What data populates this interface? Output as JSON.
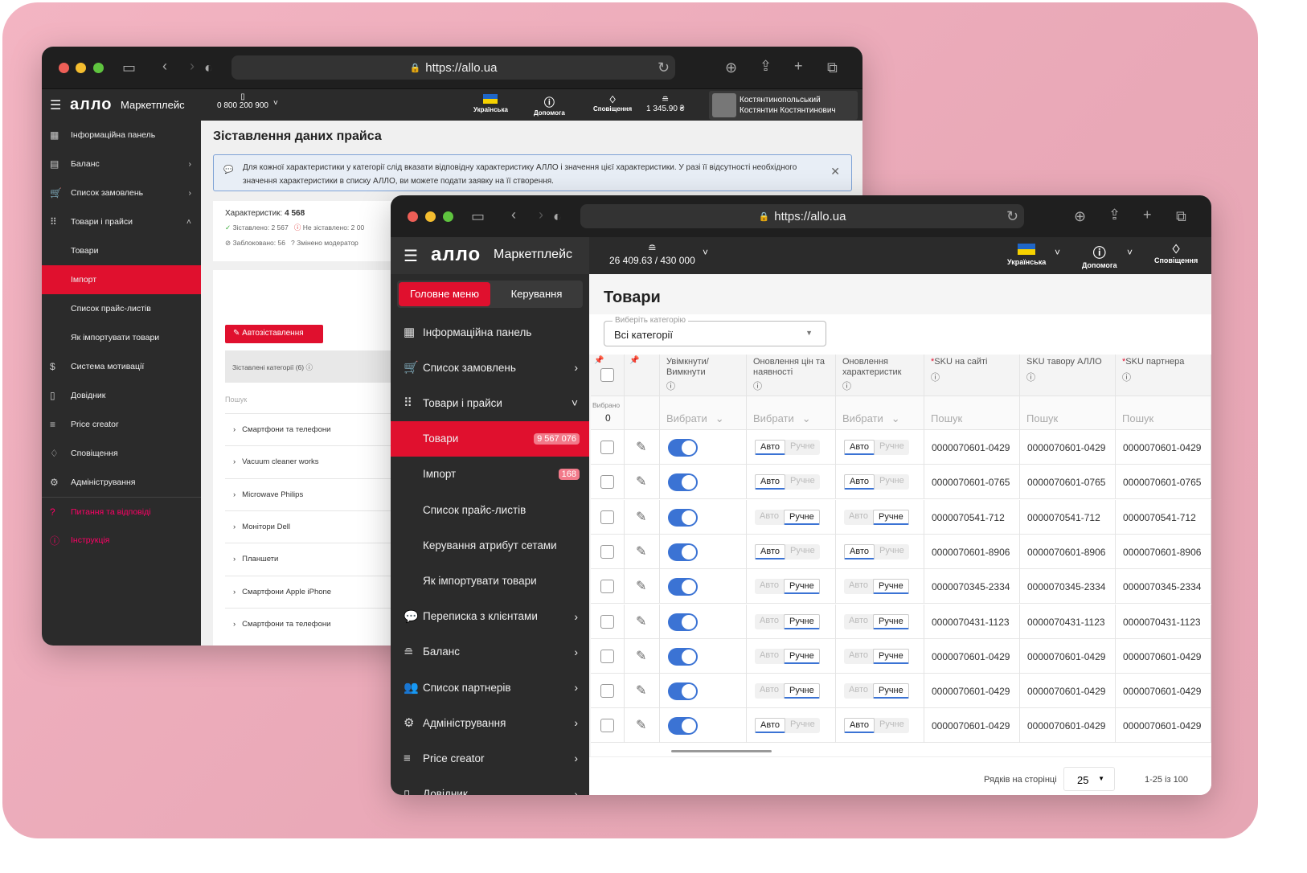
{
  "back": {
    "url": "https://allo.ua",
    "brand": "алло",
    "brand_sub": "Маркетплейс",
    "phone": "0 800 200 900",
    "language": "Українська",
    "help": "Допомога",
    "notifications": "Сповіщення",
    "balance": "1 345.90 ₴",
    "user_line1": "Костянтинопольський",
    "user_line2": "Костянтин Костянтинович",
    "sidebar": [
      {
        "label": "Інформаційна панель",
        "icon": "dashboard-icon",
        "chev": ""
      },
      {
        "label": "Баланс",
        "icon": "wallet-icon",
        "chev": "›"
      },
      {
        "label": "Список замовлень",
        "icon": "cart-icon",
        "chev": "›"
      },
      {
        "label": "Товари і прайси",
        "icon": "grid-icon",
        "chev": "˄"
      },
      {
        "label": "Товари",
        "sub": true
      },
      {
        "label": "Імпорт",
        "sub": true,
        "active": true
      },
      {
        "label": "Список прайс-листів",
        "sub": true
      },
      {
        "label": "Як імпортувати товари",
        "sub": true
      },
      {
        "label": "Система мотивації",
        "icon": "dollar-icon"
      },
      {
        "label": "Довідник",
        "icon": "book-icon"
      },
      {
        "label": "Price creator",
        "icon": "list-check-icon"
      },
      {
        "label": "Сповіщення",
        "icon": "bell-icon"
      },
      {
        "label": "Адміністрування",
        "icon": "gear-icon"
      },
      {
        "label": "Питання та відповіді",
        "icon": "question-icon",
        "red": true
      },
      {
        "label": "Інструкція",
        "icon": "info-icon",
        "red": true
      }
    ],
    "page_title": "Зіставлення даних прайса",
    "alert": "Для кожної характеристики у категорії слід вказати відповідну характеристику АЛЛО і значення цієї характеристики. У разі її відсутності необхідного значення характеристики в списку АЛЛО, ви можете подати заявку на її створення.",
    "stats": {
      "label": "Характеристик:",
      "total": "4 568",
      "matched": "Зіставлено: 2 567",
      "unmatched": "Не зіставлено: 2 00",
      "blocked": "Заблоковано: 56",
      "moderated": "Змінено модератор"
    },
    "auto_button": "Автозіставлення",
    "matched_categories": "Зіставлені категорії (6)",
    "search_placeholder": "Пошук",
    "categories": [
      "Смартфони та телефони",
      "Vacuum cleaner works",
      "Microwave Philips",
      "Монітори Dell",
      "Планшети",
      "Смартфони Apple iPhone",
      "Смартфони та телефони"
    ]
  },
  "front": {
    "url": "https://allo.ua",
    "brand": "алло",
    "brand_sub": "Маркетплейс",
    "balance": "26 409.63 / 430 000",
    "language": "Українська",
    "help": "Допомога",
    "notifications": "Сповіщення",
    "tabs": {
      "main": "Головне меню",
      "manage": "Керування"
    },
    "sidebar": [
      {
        "label": "Інформаційна панель",
        "icon": "dashboard-icon",
        "chev": ""
      },
      {
        "label": "Список замовлень",
        "icon": "cart-icon",
        "chev": "›"
      },
      {
        "label": "Товари і прайси",
        "icon": "grid-icon",
        "chev": "˅"
      },
      {
        "label": "Товари",
        "sub": true,
        "active": true,
        "badge": "9 567 076"
      },
      {
        "label": "Імпорт",
        "sub": true,
        "badge": "168"
      },
      {
        "label": "Список прайс-листів",
        "sub": true
      },
      {
        "label": "Керування атрибут сетами",
        "sub": true
      },
      {
        "label": "Як імпортувати товари",
        "sub": true
      },
      {
        "label": "Переписка з клієнтами",
        "icon": "chat-icon",
        "chev": "›"
      },
      {
        "label": "Баланс",
        "icon": "coins-icon",
        "chev": "›"
      },
      {
        "label": "Список партнерів",
        "icon": "users-icon",
        "chev": "›"
      },
      {
        "label": "Адміністрування",
        "icon": "gear-icon",
        "chev": "›"
      },
      {
        "label": "Price creator",
        "icon": "list-check-icon",
        "chev": "›"
      },
      {
        "label": "Довідник",
        "icon": "book-icon",
        "chev": "›"
      }
    ],
    "page_title": "Товари",
    "category_label": "Виберіть категорію",
    "category_value": "Всі категорії",
    "table": {
      "columns": [
        "Увімкнути/ Вимкнути",
        "Оновлення цін та наявності",
        "Оновлення характеристик",
        "SKU на сайті",
        "SKU тавору АЛЛО",
        "SKU партнера"
      ],
      "selected_label": "Вибрано",
      "selected_count": "0",
      "select_placeholder": "Вибрати",
      "search_placeholder": "Пошук",
      "auto": "Авто",
      "manual": "Ручне",
      "rows": [
        {
          "enabled": true,
          "mode": "auto",
          "sku": "0000070601-0429"
        },
        {
          "enabled": true,
          "mode": "auto",
          "sku": "0000070601-0765"
        },
        {
          "enabled": true,
          "mode": "manual",
          "sku": "0000070541-712"
        },
        {
          "enabled": true,
          "mode": "auto",
          "sku": "0000070601-8906"
        },
        {
          "enabled": true,
          "mode": "manual",
          "sku": "0000070345-2334"
        },
        {
          "enabled": true,
          "mode": "manual",
          "sku": "0000070431-1123"
        },
        {
          "enabled": true,
          "mode": "manual",
          "sku": "0000070601-0429"
        },
        {
          "enabled": true,
          "mode": "manual",
          "sku": "0000070601-0429"
        },
        {
          "enabled": true,
          "mode": "auto",
          "sku": "0000070601-0429"
        }
      ]
    },
    "pagination": {
      "rows_label": "Рядків на сторінці",
      "rows_value": "25",
      "range": "1-25 із 100"
    }
  },
  "colors": {
    "accent": "#e0102e",
    "toggle": "#3b73d4",
    "dark": "#2b2b2b"
  }
}
